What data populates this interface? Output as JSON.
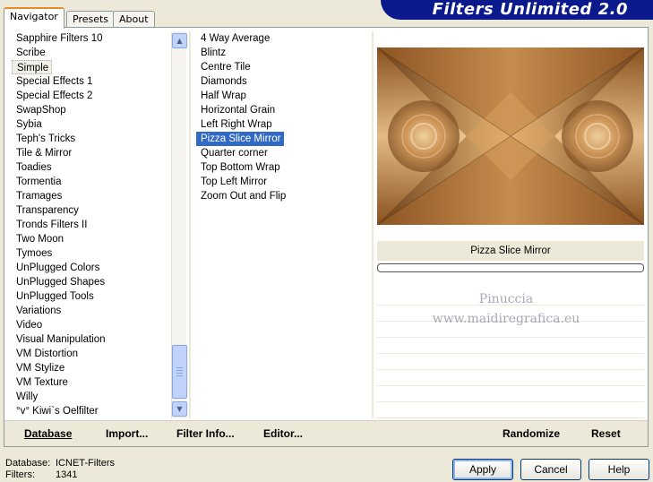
{
  "tabs": [
    "Navigator",
    "Presets",
    "About"
  ],
  "app_title": "Filters Unlimited 2.0",
  "categories": [
    "Sapphire Filters 10",
    "Scribe",
    "Simple",
    "Special Effects 1",
    "Special Effects 2",
    "SwapShop",
    "Sybia",
    "Teph's Tricks",
    "Tile & Mirror",
    "Toadies",
    "Tormentia",
    "Tramages",
    "Transparency",
    "Tronds Filters II",
    "Two Moon",
    "Tymoes",
    "UnPlugged Colors",
    "UnPlugged Shapes",
    "UnPlugged Tools",
    "Variations",
    "Video",
    "Visual Manipulation",
    "VM Distortion",
    "VM Stylize",
    "VM Texture",
    "Willy",
    "°v° Kiwi`s Oelfilter"
  ],
  "filters": [
    "4 Way Average",
    "Blintz",
    "Centre Tile",
    "Diamonds",
    "Half Wrap",
    "Horizontal Grain",
    "Left Right Wrap",
    "Pizza Slice Mirror",
    "Quarter corner",
    "Top Bottom Wrap",
    "Top Left Mirror",
    "Zoom Out and Flip"
  ],
  "selected_filter": "Pizza Slice Mirror",
  "watermark": {
    "line1": "Pinuccia",
    "line2": "www.maidiregrafica.eu"
  },
  "toolbar": {
    "database": "Database",
    "import": "Import...",
    "filter_info": "Filter Info...",
    "editor": "Editor...",
    "randomize": "Randomize",
    "reset": "Reset"
  },
  "footer": {
    "database_label": "Database:",
    "database_value": "ICNET-Filters",
    "filters_label": "Filters:",
    "filters_value": "1341"
  },
  "buttons": {
    "apply": "Apply",
    "cancel": "Cancel",
    "help": "Help"
  },
  "colors": {
    "accent": "#316ac5",
    "banner": "#0a1a8c",
    "face": "#ece9d8"
  }
}
